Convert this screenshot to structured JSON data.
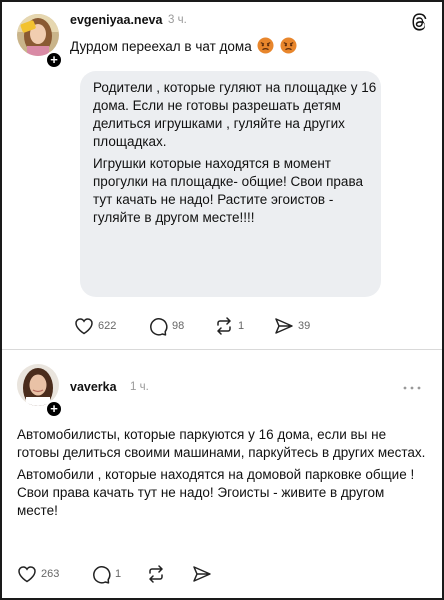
{
  "posts": [
    {
      "username": "evgeniyaa.neva",
      "time": "3 ч.",
      "caption": "Дурдом переехал в чат дома",
      "caption_emojis": [
        "angry-face-emoji",
        "angry-face-emoji"
      ],
      "quoted_message": [
        "Родители , которые гуляют на площадке у 16 дома. Если не готовы разрешать детям делиться игрушками , гуляйте на других площадках.",
        "Игрушки которые находятся в момент прогулки на площадке- общие! Свои права тут качать не надо! Растите эгоистов - гуляйте в другом месте!!!!"
      ],
      "actions": {
        "likes": "622",
        "comments": "98",
        "reposts": "1",
        "shares": "39"
      },
      "icon": "threads-logo-icon"
    },
    {
      "username": "vaverka",
      "time": "1 ч.",
      "body": [
        "Автомобилисты, которые паркуются у 16 дома, если вы не готовы делиться своими машинами, паркуйтесь в других местах.",
        "Автомобили , которые находятся на домовой парковке общие ! Свои права качать тут не надо! Эгоисты - живите в другом месте!"
      ],
      "actions": {
        "likes": "263",
        "comments": "1",
        "reposts": "",
        "shares": ""
      },
      "icon": "more-dots-icon"
    }
  ],
  "colors": {
    "bubble": "#eceef1",
    "muted": "#9a9a9a",
    "text": "#111111"
  }
}
